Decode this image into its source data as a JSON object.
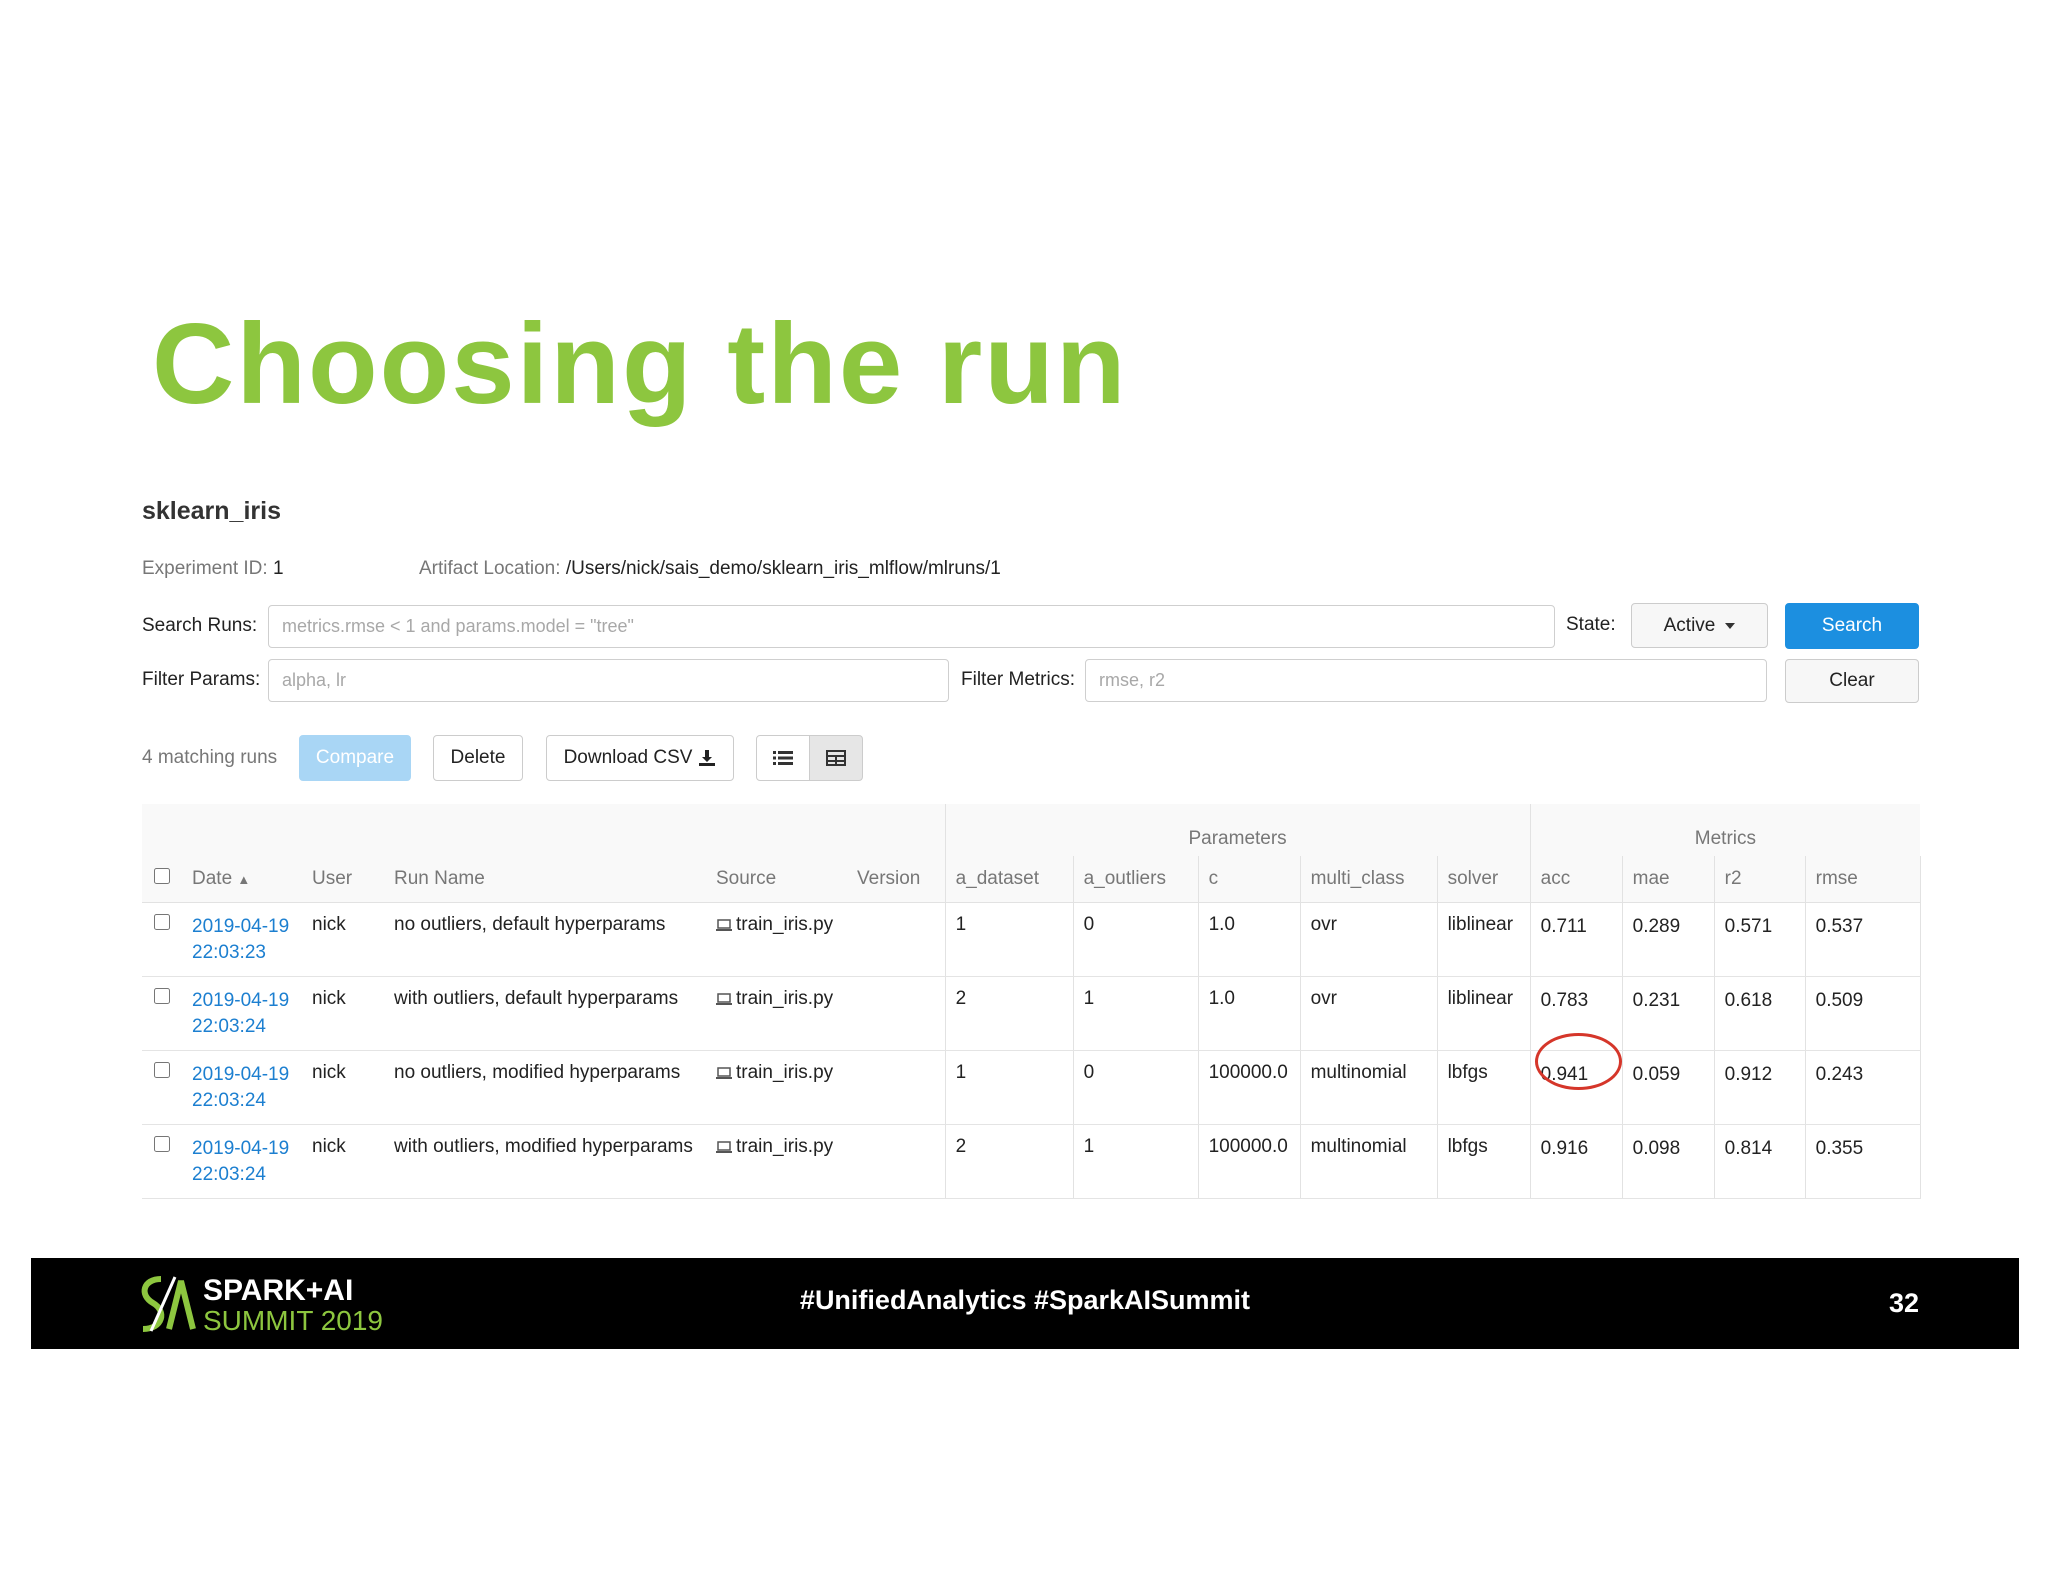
{
  "slide": {
    "title": "Choosing the run",
    "page_number": "32",
    "hashtags": "#UnifiedAnalytics #SparkAISummit",
    "logo_text_line1": "SPARK+AI",
    "logo_text_line2": "SUMMIT 2019"
  },
  "experiment": {
    "name": "sklearn_iris",
    "id_label": "Experiment ID:",
    "id_value": "1",
    "artifact_label": "Artifact Location:",
    "artifact_value": "/Users/nick/sais_demo/sklearn_iris_mlflow/mlruns/1"
  },
  "search": {
    "runs_label": "Search Runs:",
    "runs_placeholder": "metrics.rmse < 1 and params.model = \"tree\"",
    "state_label": "State:",
    "state_value": "Active",
    "search_button": "Search",
    "params_label": "Filter Params:",
    "params_placeholder": "alpha, lr",
    "metrics_label": "Filter Metrics:",
    "metrics_placeholder": "rmse, r2",
    "clear_button": "Clear"
  },
  "toolbar": {
    "matching": "4 matching runs",
    "compare": "Compare",
    "delete": "Delete",
    "download": "Download CSV"
  },
  "table": {
    "group_parameters": "Parameters",
    "group_metrics": "Metrics",
    "headers": [
      "Date",
      "User",
      "Run Name",
      "Source",
      "Version",
      "a_dataset",
      "a_outliers",
      "c",
      "multi_class",
      "solver",
      "acc",
      "mae",
      "r2",
      "rmse"
    ],
    "rows": [
      {
        "date": "2019-04-19",
        "time": "22:03:23",
        "user": "nick",
        "run_name": "no outliers, default hyperparams",
        "source": "train_iris.py",
        "version": "",
        "a_dataset": "1",
        "a_outliers": "0",
        "c": "1.0",
        "multi_class": "ovr",
        "solver": "liblinear",
        "acc": "0.711",
        "mae": "0.289",
        "r2": "0.571",
        "rmse": "0.537"
      },
      {
        "date": "2019-04-19",
        "time": "22:03:24",
        "user": "nick",
        "run_name": "with outliers, default hyperparams",
        "source": "train_iris.py",
        "version": "",
        "a_dataset": "2",
        "a_outliers": "1",
        "c": "1.0",
        "multi_class": "ovr",
        "solver": "liblinear",
        "acc": "0.783",
        "mae": "0.231",
        "r2": "0.618",
        "rmse": "0.509"
      },
      {
        "date": "2019-04-19",
        "time": "22:03:24",
        "user": "nick",
        "run_name": "no outliers, modified hyperparams",
        "source": "train_iris.py",
        "version": "",
        "a_dataset": "1",
        "a_outliers": "0",
        "c": "100000.0",
        "multi_class": "multinomial",
        "solver": "lbfgs",
        "acc": "0.941",
        "mae": "0.059",
        "r2": "0.912",
        "rmse": "0.243"
      },
      {
        "date": "2019-04-19",
        "time": "22:03:24",
        "user": "nick",
        "run_name": "with outliers, modified hyperparams",
        "source": "train_iris.py",
        "version": "",
        "a_dataset": "2",
        "a_outliers": "1",
        "c": "100000.0",
        "multi_class": "multinomial",
        "solver": "lbfgs",
        "acc": "0.916",
        "mae": "0.098",
        "r2": "0.814",
        "rmse": "0.355"
      }
    ]
  },
  "colors": {
    "title_green": "#8dc63f",
    "primary_blue": "#1c8fe0",
    "link_blue": "#1c7fd0",
    "highlight_red": "#d5362a",
    "metric_bar": "#dcebfa",
    "footer_bg": "#000000"
  },
  "icons": {
    "sort": "triangle-up-icon",
    "download": "download-icon",
    "list_view": "list-icon",
    "table_view": "grid-icon",
    "source": "laptop-icon"
  }
}
